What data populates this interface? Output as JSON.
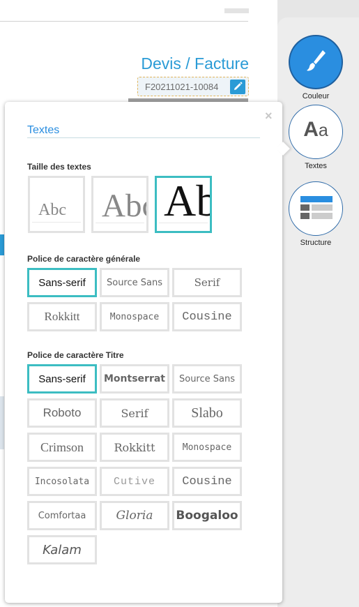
{
  "document": {
    "title": "Devis / Facture",
    "number": "F20211021-10084"
  },
  "toolbar": {
    "tools": [
      {
        "label": "Couleur",
        "icon": "brush-icon",
        "active": true
      },
      {
        "label": "Textes",
        "icon": "text-aa-icon",
        "active": false
      },
      {
        "label": "Structure",
        "icon": "layout-icon",
        "active": false
      }
    ],
    "text_icon_big": "A",
    "text_icon_small": "a"
  },
  "panel": {
    "title": "Textes",
    "close": "×",
    "size_section": {
      "label": "Taille des textes",
      "options": [
        {
          "sample": "Abc",
          "selected": false
        },
        {
          "sample": "Abc",
          "selected": false
        },
        {
          "sample": "Ab",
          "selected": true
        }
      ]
    },
    "general_font_section": {
      "label": "Police de caractère générale",
      "options": [
        {
          "label": "Sans-serif",
          "selected": true
        },
        {
          "label": "Source Sans",
          "selected": false
        },
        {
          "label": "Serif",
          "selected": false
        },
        {
          "label": "Rokkitt",
          "selected": false
        },
        {
          "label": "Monospace",
          "selected": false
        },
        {
          "label": "Cousine",
          "selected": false
        }
      ]
    },
    "title_font_section": {
      "label": "Police de caractère Titre",
      "options": [
        {
          "label": "Sans-serif",
          "selected": true
        },
        {
          "label": "Montserrat",
          "selected": false
        },
        {
          "label": "Source Sans",
          "selected": false
        },
        {
          "label": "Roboto",
          "selected": false
        },
        {
          "label": "Serif",
          "selected": false
        },
        {
          "label": "Slabo",
          "selected": false
        },
        {
          "label": "Crimson",
          "selected": false
        },
        {
          "label": "Rokkitt",
          "selected": false
        },
        {
          "label": "Monospace",
          "selected": false
        },
        {
          "label": "Incosolata",
          "selected": false
        },
        {
          "label": "Cutive",
          "selected": false
        },
        {
          "label": "Cousine",
          "selected": false
        },
        {
          "label": "Comfortaa",
          "selected": false
        },
        {
          "label": "Gloria",
          "selected": false
        },
        {
          "label": "Boogaloo",
          "selected": false
        },
        {
          "label": "Kalam",
          "selected": false
        }
      ]
    }
  },
  "colors": {
    "accent_blue": "#2a8ee0",
    "selected_border": "#3cbdc2",
    "unselected_border": "#e2e2e2"
  }
}
